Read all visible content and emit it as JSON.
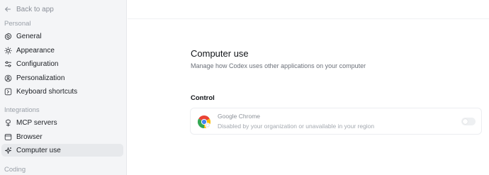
{
  "sidebar": {
    "back_label": "Back to app",
    "sections": [
      {
        "label": "Personal"
      },
      {
        "label": "Integrations"
      },
      {
        "label": "Coding"
      }
    ],
    "items": [
      {
        "label": "General",
        "icon": "gear-icon"
      },
      {
        "label": "Appearance",
        "icon": "sun-icon"
      },
      {
        "label": "Configuration",
        "icon": "sliders-icon"
      },
      {
        "label": "Personalization",
        "icon": "user-circle-icon"
      },
      {
        "label": "Keyboard shortcuts",
        "icon": "keyboard-icon"
      },
      {
        "label": "MCP servers",
        "icon": "server-icon"
      },
      {
        "label": "Browser",
        "icon": "browser-icon"
      },
      {
        "label": "Computer use",
        "icon": "sparkle-icon",
        "active": true
      }
    ]
  },
  "main": {
    "title": "Computer use",
    "subtitle": "Manage how Codex uses other applications on your computer",
    "control_label": "Control",
    "apps": [
      {
        "name": "Google Chrome",
        "description": "Disabled by your organization or unavailable in your region",
        "icon": "chrome-icon",
        "enabled": false
      }
    ]
  },
  "colors": {
    "sidebar_bg": "#f4f5f7",
    "active_item_bg": "#e7e9ec",
    "chrome_red": "#ea4335",
    "chrome_yellow": "#fbbc04",
    "chrome_green": "#34a853",
    "chrome_blue": "#4285f4"
  }
}
